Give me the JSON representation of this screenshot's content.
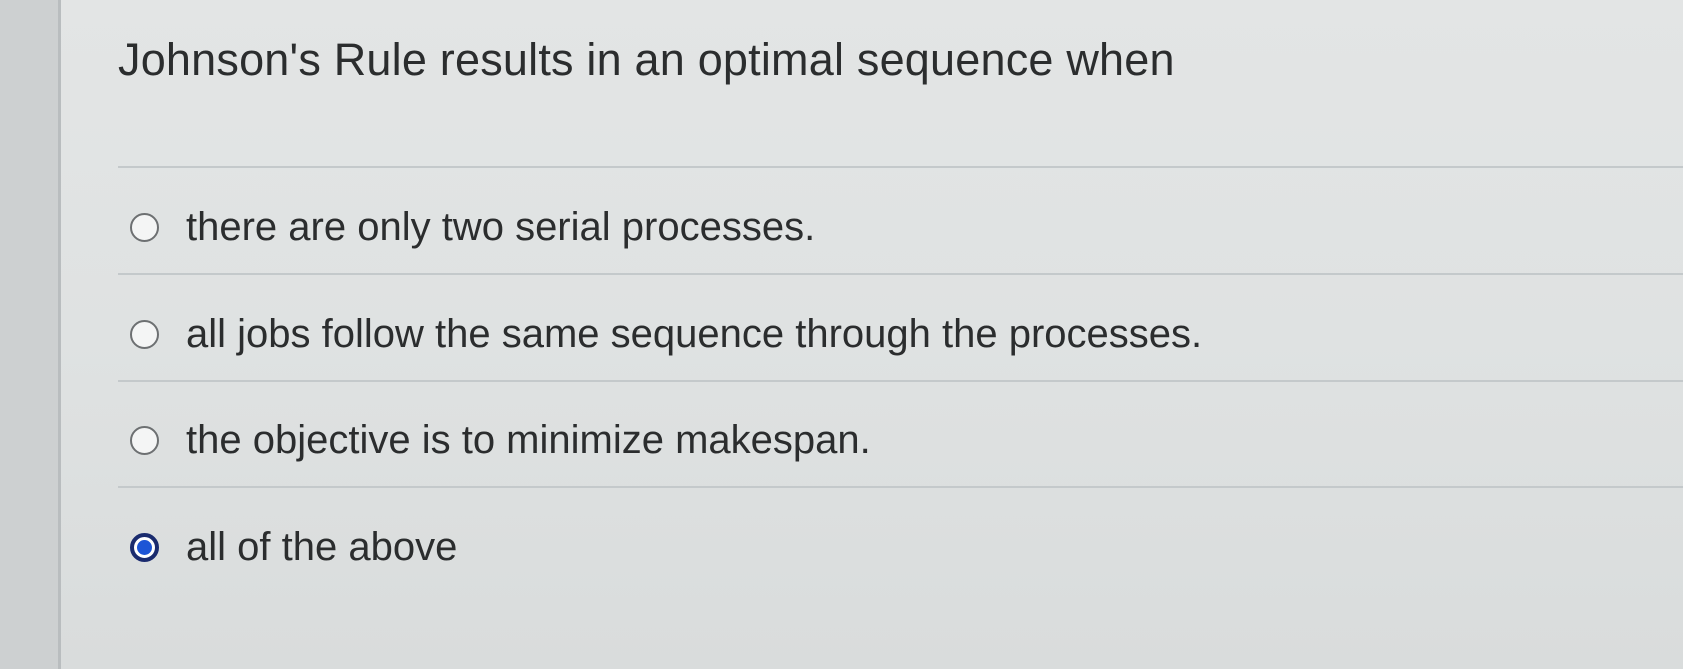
{
  "question": {
    "text": "Johnson's Rule results in an optimal sequence when"
  },
  "options": [
    {
      "label": "there are only two serial processes.",
      "selected": false
    },
    {
      "label": "all jobs follow the same sequence through the processes.",
      "selected": false
    },
    {
      "label": "the objective is to minimize makespan.",
      "selected": false
    },
    {
      "label": "all of the above",
      "selected": true
    }
  ],
  "colors": {
    "selected_radio_fill": "#1d55d6",
    "selected_radio_ring": "#1a2b6e",
    "text": "#2b2d2e"
  }
}
